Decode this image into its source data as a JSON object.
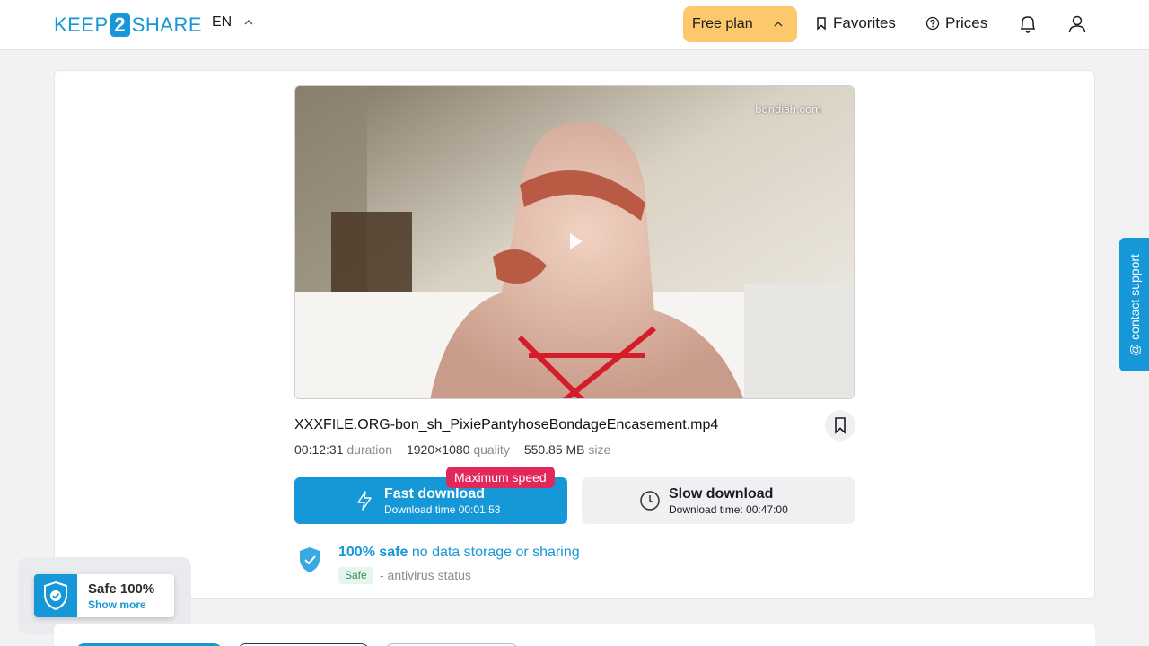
{
  "header": {
    "logo_left": "KEEP",
    "logo_mid": "2",
    "logo_right": "SHARE",
    "language": "EN",
    "plan_label": "Free plan",
    "favorites_label": "Favorites",
    "prices_label": "Prices"
  },
  "video": {
    "watermark": "bondish.com"
  },
  "file": {
    "name": "XXXFILE.ORG-bon_sh_PixiePantyhoseBondageEncasement.mp4",
    "duration_value": "00:12:31",
    "duration_label": "duration",
    "quality_value": "1920×1080",
    "quality_label": "quality",
    "size_value": "550.85 MB",
    "size_label": "size"
  },
  "download": {
    "fast_title": "Fast download",
    "fast_time": "Download time 00:01:53",
    "badge": "Maximum speed",
    "slow_title": "Slow download",
    "slow_time": "Download time: 00:47:00"
  },
  "safety": {
    "bold": "100% safe",
    "rest": "no data storage or sharing",
    "pill": "Safe",
    "status": "- antivirus status"
  },
  "floating_badge": {
    "title": "Safe 100%",
    "link": "Show more"
  },
  "support": {
    "label": "@ contact support"
  },
  "colors": {
    "accent": "#1597d8",
    "plan": "#fcc86a",
    "badge": "#e2285a"
  }
}
